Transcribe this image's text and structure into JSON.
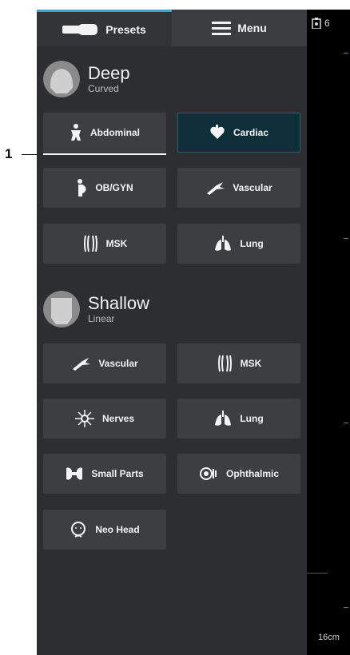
{
  "callout": {
    "number": "1"
  },
  "tabs": {
    "presets": "Presets",
    "menu": "Menu"
  },
  "deep": {
    "title": "Deep",
    "subtitle": "Curved",
    "buttons": [
      "Abdominal",
      "Cardiac",
      "OB/GYN",
      "Vascular",
      "MSK",
      "Lung"
    ]
  },
  "shallow": {
    "title": "Shallow",
    "subtitle": "Linear",
    "buttons": [
      "Vascular",
      "MSK",
      "Nerves",
      "Lung",
      "Small Parts",
      "Ophthalmic",
      "Neo Head"
    ]
  },
  "image_area": {
    "header_value": "6",
    "depth": "16cm"
  },
  "colors": {
    "accent": "#3aa6c9",
    "active_bg": "#0e2f3a",
    "panel": "#2d2e31",
    "button": "#3d3e42"
  }
}
